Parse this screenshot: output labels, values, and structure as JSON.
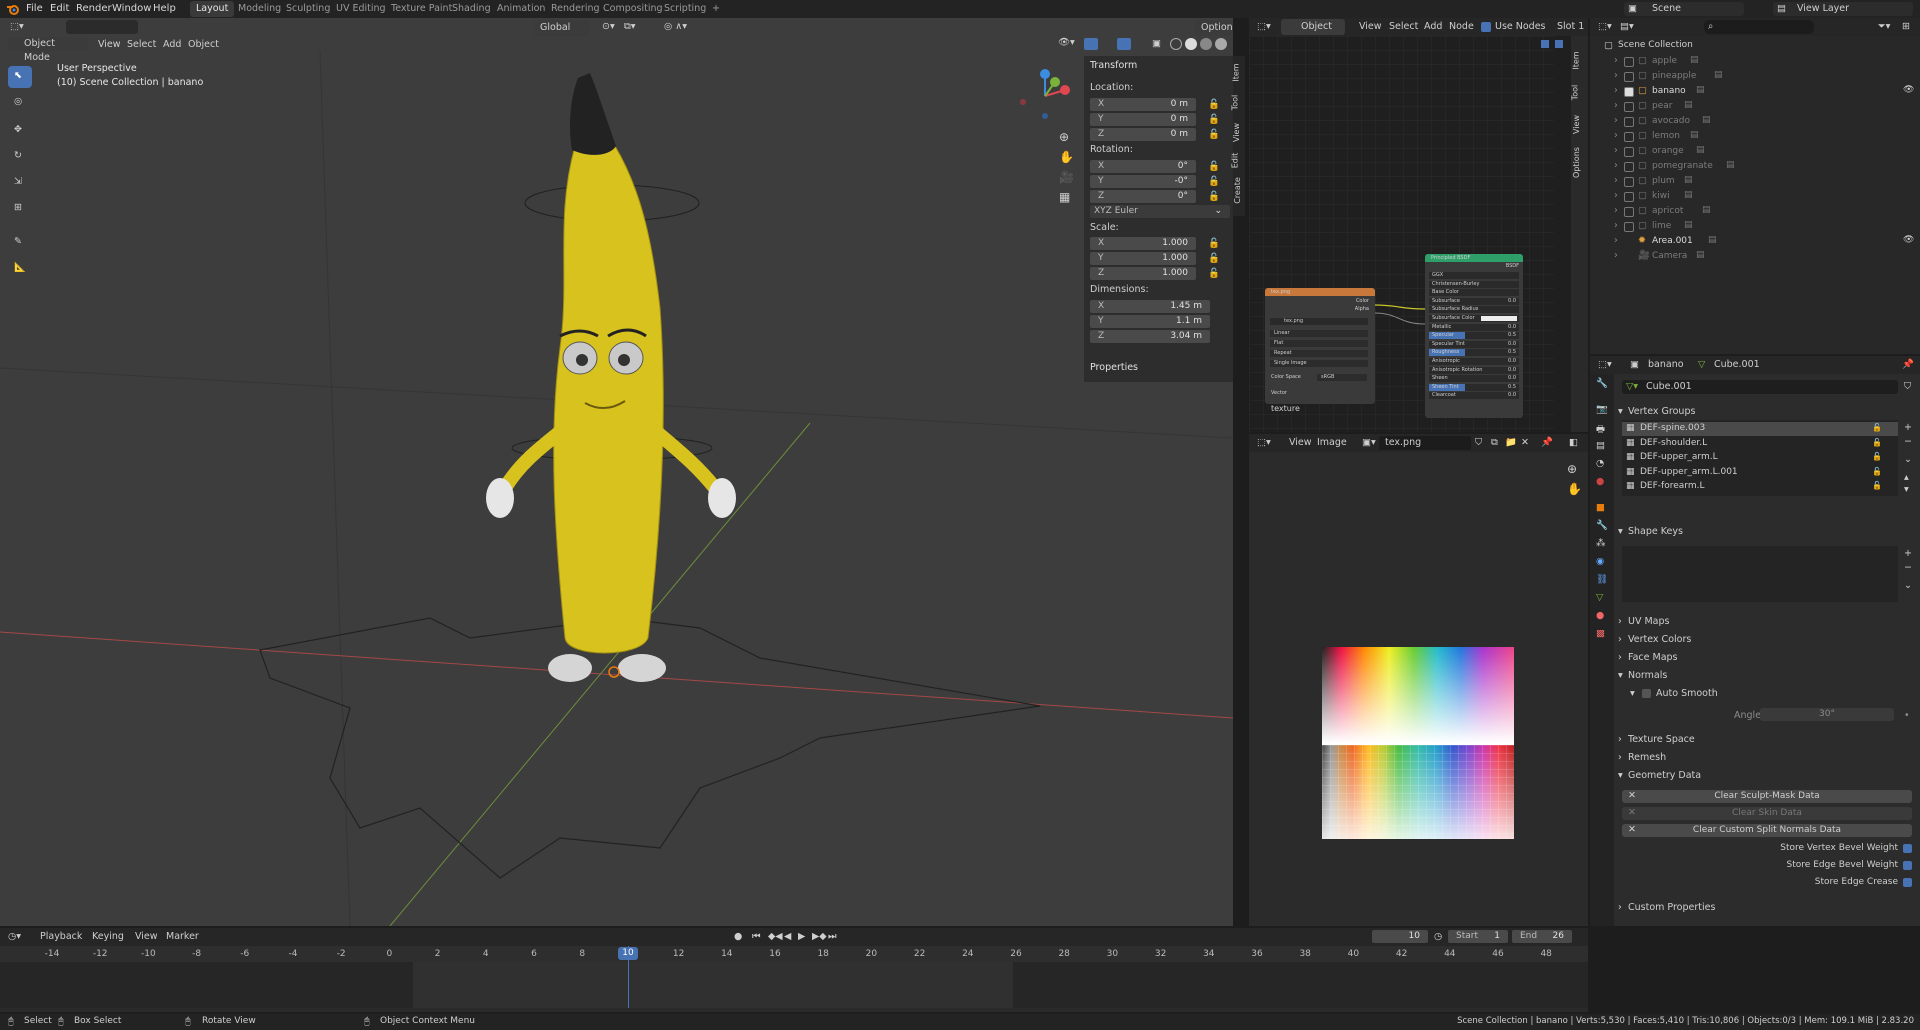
{
  "top_menu": {
    "items": [
      "File",
      "Edit",
      "Render",
      "Window",
      "Help"
    ],
    "workspace_tabs": [
      "Layout",
      "Modeling",
      "Sculpting",
      "UV Editing",
      "Texture Paint",
      "Shading",
      "Animation",
      "Rendering",
      "Compositing",
      "Scripting"
    ],
    "active_tab": "Layout",
    "add_tab": "+",
    "scene_name": "Scene",
    "view_layer": "View Layer"
  },
  "viewport_header": {
    "mode": "Object Mode",
    "menus": [
      "View",
      "Select",
      "Add",
      "Object"
    ],
    "orientation": "Global",
    "options": "Options"
  },
  "viewport": {
    "perspective": "User Perspective",
    "collection_info": "(10) Scene Collection | banano"
  },
  "n_panel": {
    "transform_title": "Transform",
    "location_label": "Location:",
    "location": [
      {
        "axis": "X",
        "value": "0 m"
      },
      {
        "axis": "Y",
        "value": "0 m"
      },
      {
        "axis": "Z",
        "value": "0 m"
      }
    ],
    "rotation_label": "Rotation:",
    "rotation": [
      {
        "axis": "X",
        "value": "0°"
      },
      {
        "axis": "Y",
        "value": "-0°"
      },
      {
        "axis": "Z",
        "value": "0°"
      }
    ],
    "rotation_mode": "XYZ Euler",
    "scale_label": "Scale:",
    "scale": [
      {
        "axis": "X",
        "value": "1.000"
      },
      {
        "axis": "Y",
        "value": "1.000"
      },
      {
        "axis": "Z",
        "value": "1.000"
      }
    ],
    "dimensions_label": "Dimensions:",
    "dimensions": [
      {
        "axis": "X",
        "value": "1.45 m"
      },
      {
        "axis": "Y",
        "value": "1.1 m"
      },
      {
        "axis": "Z",
        "value": "3.04 m"
      }
    ],
    "properties_title": "Properties",
    "side_tabs": [
      "Item",
      "Tool",
      "View",
      "Edit",
      "Create"
    ]
  },
  "node_editor": {
    "object_label": "Object",
    "menus": [
      "View",
      "Select",
      "Add",
      "Node"
    ],
    "use_nodes": "Use Nodes",
    "slot": "Slot 1",
    "side_tabs": [
      "Item",
      "Tool",
      "View",
      "Options"
    ],
    "texture_node": {
      "title": "tex.png",
      "outputs": [
        "Color",
        "Alpha"
      ],
      "image": "tex.png",
      "rows": [
        "Linear",
        "Flat",
        "Repeat",
        "Single Image"
      ],
      "color_space_label": "Color Space",
      "color_space": "sRGB",
      "vector": "Vector",
      "frame_label": "texture"
    },
    "bsdf_node": {
      "title": "Principled BSDF",
      "output": "BSDF",
      "rows": [
        {
          "label": "GGX",
          "value": ""
        },
        {
          "label": "Christensen-Burley",
          "value": ""
        },
        {
          "label": "Base Color",
          "value": ""
        },
        {
          "label": "Subsurface",
          "value": "0.0"
        },
        {
          "label": "Subsurface Radius",
          "value": ""
        },
        {
          "label": "Subsurface Color",
          "value": ""
        },
        {
          "label": "Metallic",
          "value": "0.0"
        },
        {
          "label": "Specular",
          "value": "0.5"
        },
        {
          "label": "Specular Tint",
          "value": "0.0"
        },
        {
          "label": "Roughness",
          "value": "0.5"
        },
        {
          "label": "Anisotropic",
          "value": "0.0"
        },
        {
          "label": "Anisotropic Rotation",
          "value": "0.0"
        },
        {
          "label": "Sheen",
          "value": "0.0"
        },
        {
          "label": "Sheen Tint",
          "value": "0.5"
        },
        {
          "label": "Clearcoat",
          "value": "0.0"
        }
      ]
    }
  },
  "image_editor": {
    "menus": [
      "View",
      "Image"
    ],
    "image_name": "tex.png"
  },
  "outliner": {
    "root": "Scene Collection",
    "items": [
      {
        "name": "apple",
        "dim": true,
        "checked": false,
        "eye": false
      },
      {
        "name": "pineapple",
        "dim": true,
        "checked": false,
        "eye": false
      },
      {
        "name": "banano",
        "dim": false,
        "checked": true,
        "eye": true
      },
      {
        "name": "pear",
        "dim": true,
        "checked": false,
        "eye": false
      },
      {
        "name": "avocado",
        "dim": true,
        "checked": false,
        "eye": false
      },
      {
        "name": "lemon",
        "dim": true,
        "checked": false,
        "eye": false
      },
      {
        "name": "orange",
        "dim": true,
        "checked": false,
        "eye": false
      },
      {
        "name": "pomegranate",
        "dim": true,
        "checked": false,
        "eye": false
      },
      {
        "name": "plum",
        "dim": true,
        "checked": false,
        "eye": false
      },
      {
        "name": "kiwi",
        "dim": true,
        "checked": false,
        "eye": false
      },
      {
        "name": "apricot",
        "dim": true,
        "checked": false,
        "eye": false
      },
      {
        "name": "lime",
        "dim": true,
        "checked": false,
        "eye": false
      },
      {
        "name": "Area.001",
        "dim": false,
        "checked": null,
        "eye": true
      },
      {
        "name": "Camera",
        "dim": true,
        "checked": null,
        "eye": false
      }
    ]
  },
  "properties": {
    "object_name": "banano",
    "mesh_name": "Cube.001",
    "mesh_field": "Cube.001",
    "vertex_groups_title": "Vertex Groups",
    "vertex_groups": [
      "DEF-spine.003",
      "DEF-shoulder.L",
      "DEF-upper_arm.L",
      "DEF-upper_arm.L.001",
      "DEF-forearm.L"
    ],
    "shape_keys_title": "Shape Keys",
    "uv_maps": "UV Maps",
    "vertex_colors": "Vertex Colors",
    "face_maps": "Face Maps",
    "normals": "Normals",
    "auto_smooth": "Auto Smooth",
    "angle_label": "Angle",
    "angle_value": "30°",
    "texture_space": "Texture Space",
    "remesh": "Remesh",
    "geometry_data": "Geometry Data",
    "clear_sculpt": "Clear Sculpt-Mask Data",
    "clear_skin": "Clear Skin Data",
    "clear_normals": "Clear Custom Split Normals Data",
    "store_vertex_bevel": "Store Vertex Bevel Weight",
    "store_edge_bevel": "Store Edge Bevel Weight",
    "store_edge_crease": "Store Edge Crease",
    "custom_properties": "Custom Properties"
  },
  "timeline": {
    "menus": [
      "Playback",
      "Keying",
      "View",
      "Marker"
    ],
    "current_frame": "10",
    "start_label": "Start",
    "start": "1",
    "end_label": "End",
    "end": "26",
    "ticks": [
      "-14",
      "-12",
      "-10",
      "-8",
      "-6",
      "-4",
      "-2",
      "0",
      "2",
      "4",
      "6",
      "8",
      "10",
      "12",
      "14",
      "16",
      "18",
      "20",
      "22",
      "24",
      "26",
      "28",
      "30",
      "32",
      "34",
      "36",
      "38",
      "40",
      "42",
      "44",
      "46",
      "48"
    ]
  },
  "status_bar": {
    "select": "Select",
    "box_select": "Box Select",
    "rotate_view": "Rotate View",
    "context_menu": "Object Context Menu",
    "stats": "Scene Collection | banano | Verts:5,530 | Faces:5,410 | Tris:10,806 | Objects:0/3 | Mem: 109.1 MiB | 2.83.20"
  },
  "colors": {
    "accent": "#4772b3",
    "x_axis": "#e2464f",
    "y_axis": "#7ab33c",
    "z_axis": "#3c8ce2",
    "banana": "#d8c21e",
    "texture_node_header": "#c7783a",
    "bsdf_node_header": "#2f9f6a"
  }
}
